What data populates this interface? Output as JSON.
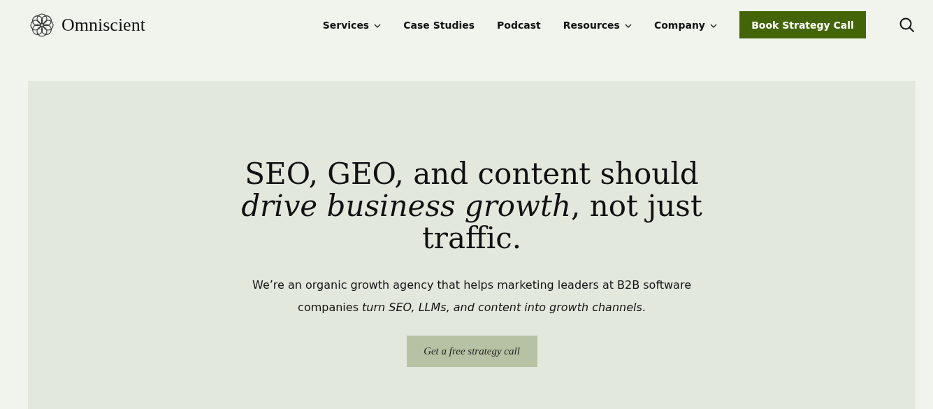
{
  "logo": {
    "name": "Omniscient"
  },
  "nav": [
    {
      "label": "Services",
      "dropdown": true
    },
    {
      "label": "Case Studies",
      "dropdown": false
    },
    {
      "label": "Podcast",
      "dropdown": false
    },
    {
      "label": "Resources",
      "dropdown": true
    },
    {
      "label": "Company",
      "dropdown": true
    }
  ],
  "cta": "Book Strategy Call",
  "hero": {
    "headline": "SEO, GEO, and content should *drive business growth*, not just traffic.",
    "subtitle": "We’re an organic growth agency that helps marketing leaders at B2B software companies *turn SEO, LLMs, and content into growth channels*.",
    "button": "Get a free strategy call"
  }
}
